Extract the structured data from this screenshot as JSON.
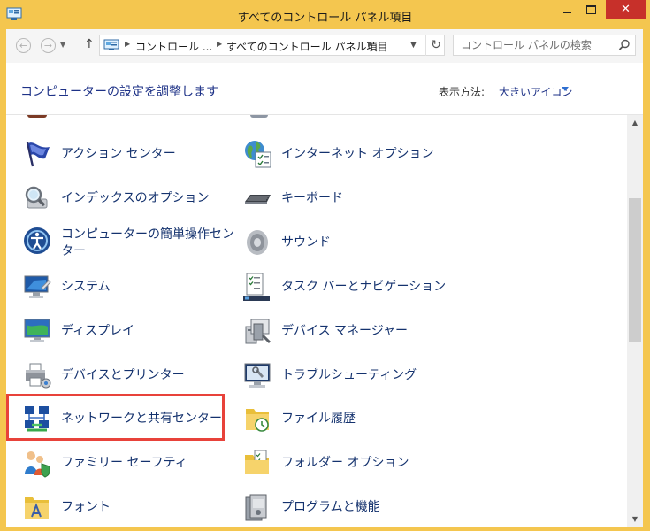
{
  "window": {
    "title": "すべてのコントロール パネル項目"
  },
  "titlebar": {
    "close_glyph": "✕"
  },
  "address": {
    "crumbs": [
      "コントロール ...",
      "すべてのコントロール パネル項目"
    ],
    "search_placeholder": "コントロール パネルの検索"
  },
  "header": {
    "title": "コンピューターの設定を調整します",
    "view_label": "表示方法:",
    "view_value": "大きいアイコン"
  },
  "items": [
    {
      "label": "アクション センター",
      "icon": "flag-icon"
    },
    {
      "label": "インターネット オプション",
      "icon": "globe-checklist-icon"
    },
    {
      "label": "インデックスのオプション",
      "icon": "magnifier-icon"
    },
    {
      "label": "キーボード",
      "icon": "keyboard-icon"
    },
    {
      "label": "コンピューターの簡単操作センター",
      "icon": "ease-of-access-icon"
    },
    {
      "label": "サウンド",
      "icon": "speaker-icon"
    },
    {
      "label": "システム",
      "icon": "system-monitor-icon"
    },
    {
      "label": "タスク バーとナビゲーション",
      "icon": "taskbar-icon"
    },
    {
      "label": "ディスプレイ",
      "icon": "display-icon"
    },
    {
      "label": "デバイス マネージャー",
      "icon": "device-manager-icon"
    },
    {
      "label": "デバイスとプリンター",
      "icon": "printer-icon"
    },
    {
      "label": "トラブルシューティング",
      "icon": "troubleshoot-icon"
    },
    {
      "label": "ネットワークと共有センター",
      "icon": "network-icon"
    },
    {
      "label": "ファイル履歴",
      "icon": "file-history-icon"
    },
    {
      "label": "ファミリー セーフティ",
      "icon": "family-safety-icon"
    },
    {
      "label": "フォルダー オプション",
      "icon": "folder-options-icon"
    },
    {
      "label": "フォント",
      "icon": "fonts-icon"
    },
    {
      "label": "プログラムと機能",
      "icon": "programs-icon"
    }
  ],
  "colors": {
    "accent": "#f4c64f",
    "highlight": "#e8423a",
    "link": "#14326e"
  }
}
